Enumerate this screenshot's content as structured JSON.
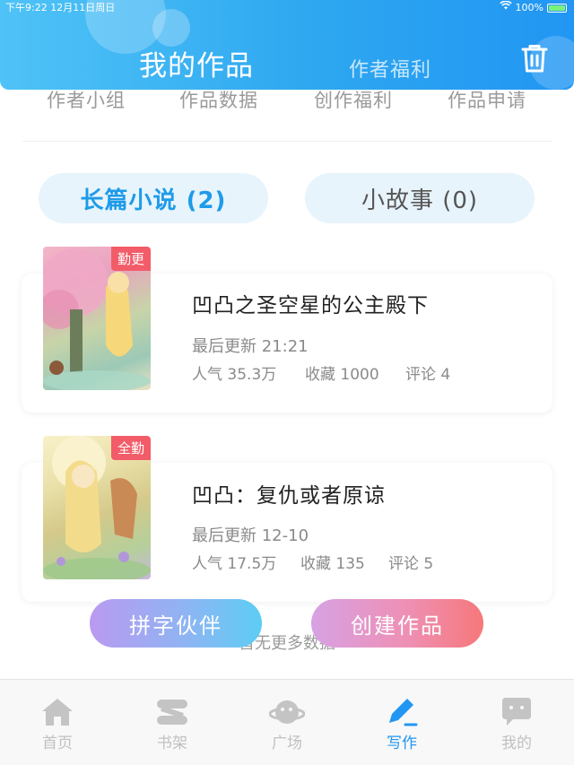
{
  "status_bar": {
    "time": "下午9:22   12月11日周日",
    "battery": "100%"
  },
  "header": {
    "main_tab": "我的作品",
    "sub_tab": "作者福利",
    "trash_icon": "trash-icon"
  },
  "quick_links": [
    "作者小组",
    "作品数据",
    "创作福利",
    "作品申请"
  ],
  "segments": {
    "novel": "长篇小说 (2)",
    "story": "小故事 (0)"
  },
  "books": [
    {
      "badge": "勤更",
      "title": "凹凸之圣空星的公主殿下",
      "update": "最后更新 21:21",
      "popularity": "人气 35.3万",
      "favorites": "收藏 1000",
      "comments": "评论 4"
    },
    {
      "badge": "全勤",
      "title": "凹凸：复仇或者原谅",
      "update": "最后更新 12-10",
      "popularity": "人气 17.5万",
      "favorites": "收藏 135",
      "comments": "评论 5"
    }
  ],
  "footer_text": "暂无更多数据",
  "buttons": {
    "partner": "拼字伙伴",
    "create": "创建作品"
  },
  "tabbar": [
    {
      "label": "首页",
      "icon": "home-icon"
    },
    {
      "label": "书架",
      "icon": "bookshelf-icon"
    },
    {
      "label": "广场",
      "icon": "planet-icon"
    },
    {
      "label": "写作",
      "icon": "pen-icon"
    },
    {
      "label": "我的",
      "icon": "chat-bubble-icon"
    }
  ],
  "colors": {
    "accent": "#2196f3",
    "badge": "#f25c68"
  }
}
